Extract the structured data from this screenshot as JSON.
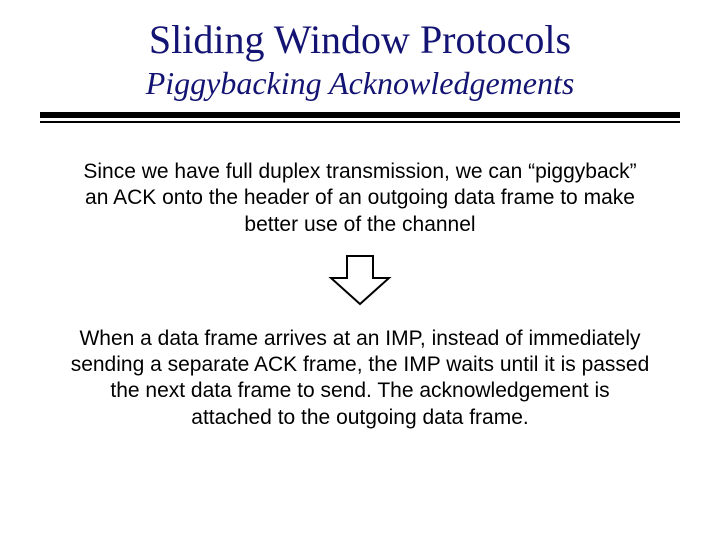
{
  "title": "Sliding Window Protocols",
  "subtitle": "Piggybacking Acknowledgements",
  "paragraph1": "Since we have full duplex transmission, we can “piggyback” an ACK onto the header of an outgoing data frame to make better use of the channel",
  "paragraph2": "When a data frame arrives at an IMP, instead of immediately sending a separate ACK frame, the IMP waits until it is passed the next data frame to send. The acknowledgement is attached to the outgoing data frame."
}
